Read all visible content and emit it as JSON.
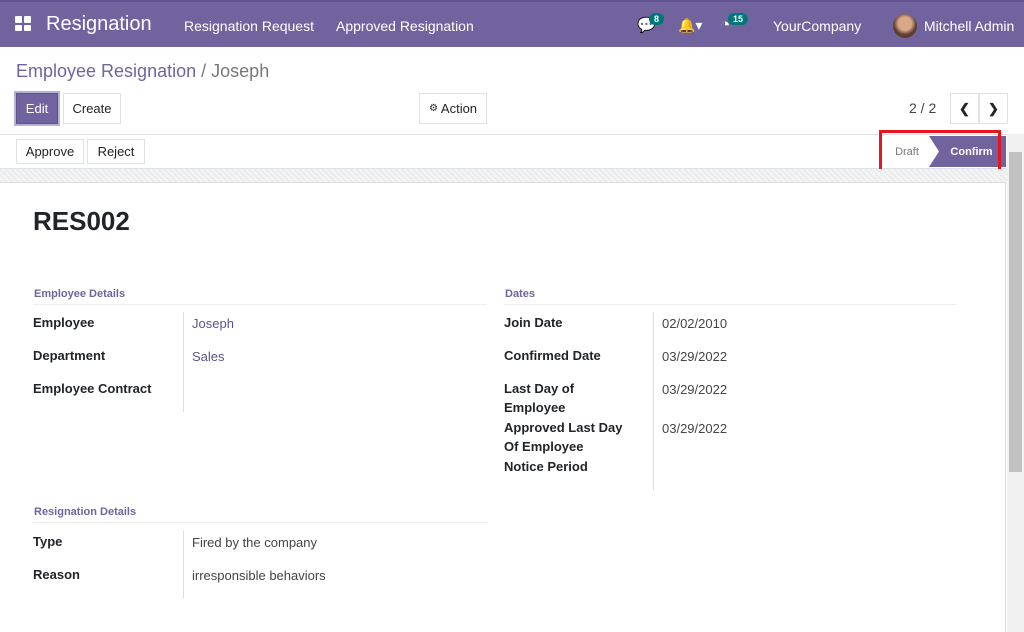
{
  "navbar": {
    "app_title": "Resignation",
    "menu": [
      "Resignation Request",
      "Approved Resignation"
    ],
    "messages_count": "8",
    "activities_count": "15",
    "company": "YourCompany",
    "user": "Mitchell Admin"
  },
  "breadcrumb": {
    "parent": "Employee Resignation",
    "separator": "/",
    "current": "Joseph"
  },
  "toolbar": {
    "edit": "Edit",
    "create": "Create",
    "action": "Action",
    "pager": "2 / 2"
  },
  "statusbar": {
    "approve": "Approve",
    "reject": "Reject",
    "stages": [
      "Draft",
      "Confirm"
    ],
    "active_stage": "Confirm",
    "highlight_color": "#e8141f"
  },
  "form": {
    "title": "RES002",
    "employee_details": {
      "header": "Employee Details",
      "fields": [
        {
          "label": "Employee",
          "value": "Joseph"
        },
        {
          "label": "Department",
          "value": "Sales"
        },
        {
          "label": "Employee Contract",
          "value": ""
        }
      ]
    },
    "dates": {
      "header": "Dates",
      "fields": [
        {
          "label": "Join Date",
          "value": "02/02/2010"
        },
        {
          "label": "Confirmed Date",
          "value": "03/29/2022"
        },
        {
          "label": "Last Day of Employee",
          "value": "03/29/2022"
        },
        {
          "label": "Approved Last Day Of Employee",
          "value": "03/29/2022"
        },
        {
          "label": "Notice Period",
          "value": ""
        }
      ]
    },
    "resignation_details": {
      "header": "Resignation Details",
      "fields": [
        {
          "label": "Type",
          "value": "Fired by the company"
        },
        {
          "label": "Reason",
          "value": "irresponsible behaviors"
        }
      ]
    }
  },
  "colors": {
    "brand": "#71639e"
  }
}
